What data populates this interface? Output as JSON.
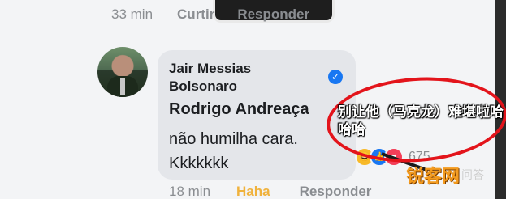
{
  "top_meta": {
    "time": "33 min",
    "like_label": "Curtir",
    "reply_label": "Responder"
  },
  "comment": {
    "author": "Jair Messias Bolsonaro",
    "mention": "Rodrigo Andreaça",
    "text_line1": "não humilha cara.",
    "text_line2": "Kkkkkkk",
    "reaction_count": "675"
  },
  "bottom_meta": {
    "time": "18 min",
    "haha_label": "Haha",
    "reply_label": "Responder"
  },
  "annotation": {
    "text": "别让他（马克龙）难堪啦哈哈哈"
  },
  "watermark": {
    "brand": "锐客网",
    "suffix": "问答"
  },
  "icons": {
    "verified": "verified-check-icon",
    "reactions": [
      "haha-icon",
      "like-icon",
      "love-icon"
    ]
  },
  "colors": {
    "facebook_blue": "#1877f2",
    "haha_yellow": "#f0b23c",
    "annotation_red": "#e3141b"
  }
}
